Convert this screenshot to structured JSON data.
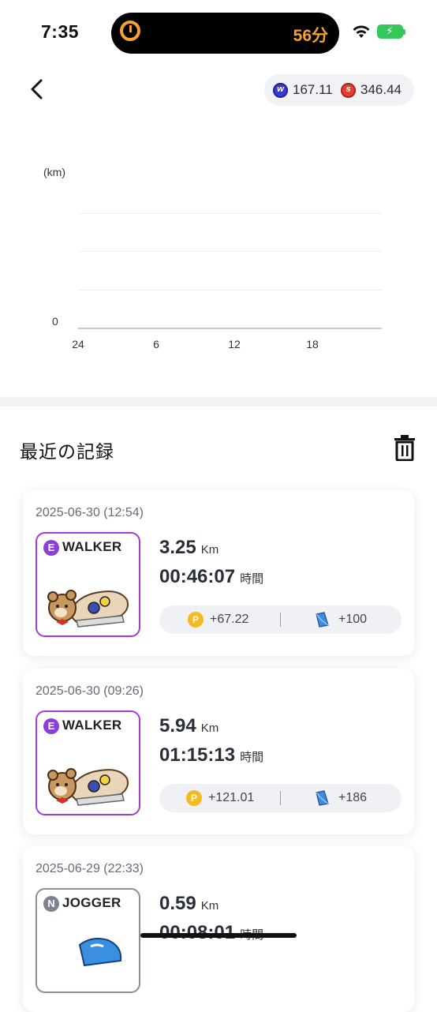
{
  "status_bar": {
    "time": "7:35",
    "timer": "56分"
  },
  "header": {
    "balances": [
      {
        "icon": "w-coin-icon",
        "value": "167.11"
      },
      {
        "icon": "s-coin-icon",
        "value": "346.44"
      }
    ]
  },
  "chart_data": {
    "type": "line",
    "ylabel": "(km)",
    "y_ticks": [
      "0"
    ],
    "x_ticks": [
      "24",
      "6",
      "12",
      "18"
    ],
    "series": [],
    "grid": true
  },
  "section": {
    "title": "最近の記録"
  },
  "records": [
    {
      "date": "2025-06-30 (12:54)",
      "badge": "E",
      "shoe_type": "WALKER",
      "distance": "3.25",
      "distance_unit": "Km",
      "duration": "00:46:07",
      "duration_unit": "時間",
      "points": "+67.22",
      "gems": "+100"
    },
    {
      "date": "2025-06-30 (09:26)",
      "badge": "E",
      "shoe_type": "WALKER",
      "distance": "5.94",
      "distance_unit": "Km",
      "duration": "01:15:13",
      "duration_unit": "時間",
      "points": "+121.01",
      "gems": "+186"
    },
    {
      "date": "2025-06-29 (22:33)",
      "badge": "N",
      "shoe_type": "JOGGER",
      "distance": "0.59",
      "distance_unit": "Km",
      "duration": "00:08:01",
      "duration_unit": "時間"
    }
  ],
  "colors": {
    "accent": "#f3a32e",
    "epic": "#8b3fd6",
    "normal": "#7d8190"
  }
}
